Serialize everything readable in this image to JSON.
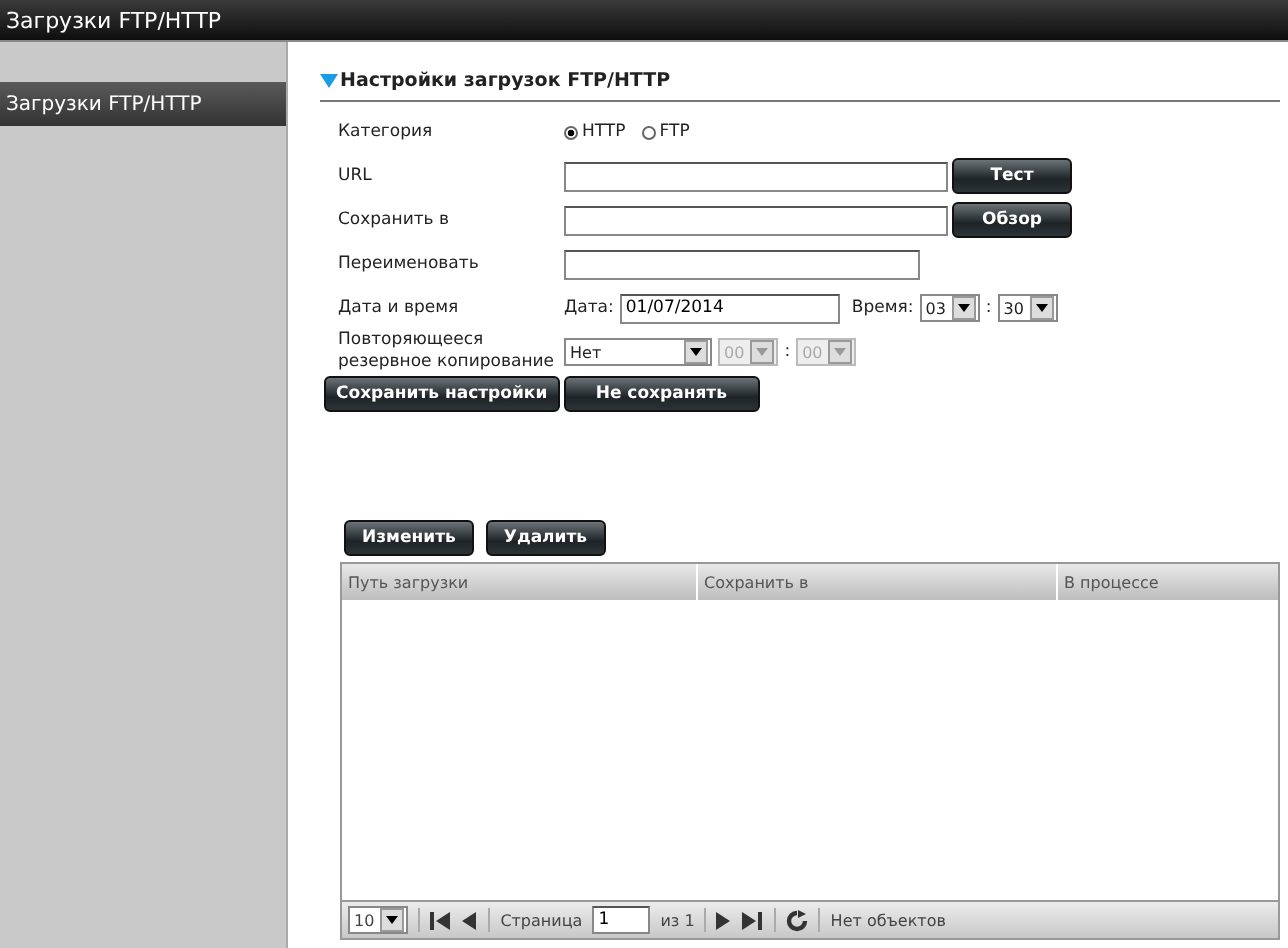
{
  "window": {
    "title": "Загрузки FTP/HTTP"
  },
  "sidebar": {
    "items": [
      {
        "label": "Загрузки FTP/HTTP",
        "selected": true
      }
    ]
  },
  "section": {
    "title": "Настройки загрузок FTP/HTTP",
    "expanded": true
  },
  "form": {
    "category": {
      "label": "Категория",
      "options": [
        {
          "label": "HTTP",
          "selected": true
        },
        {
          "label": "FTP",
          "selected": false
        }
      ]
    },
    "url": {
      "label": "URL",
      "button": "Тест"
    },
    "save_to": {
      "label": "Сохранить в",
      "button": "Обзор"
    },
    "rename": {
      "label": "Переименовать"
    },
    "datetime": {
      "label": "Дата и время",
      "date_label": "Дата:",
      "date": "01/07/2014",
      "time_label": "Время:",
      "hour": "03",
      "separator": ":",
      "minute": "30"
    },
    "repeat": {
      "label": "Повторяющееся резервное копирование",
      "value": "Нет",
      "hour": "00",
      "separator": ":",
      "minute": "00",
      "time_disabled": true
    },
    "buttons": [
      "Сохранить настройки",
      "Не сохранять"
    ]
  },
  "list_buttons": [
    "Изменить",
    "Удалить"
  ],
  "table": {
    "columns": [
      "Путь загрузки",
      "Сохранить в",
      "В процессе"
    ]
  },
  "pager": {
    "page_size": "10",
    "page_label": "Страница",
    "page": "1",
    "of": "из 1",
    "status": "Нет объектов"
  }
}
